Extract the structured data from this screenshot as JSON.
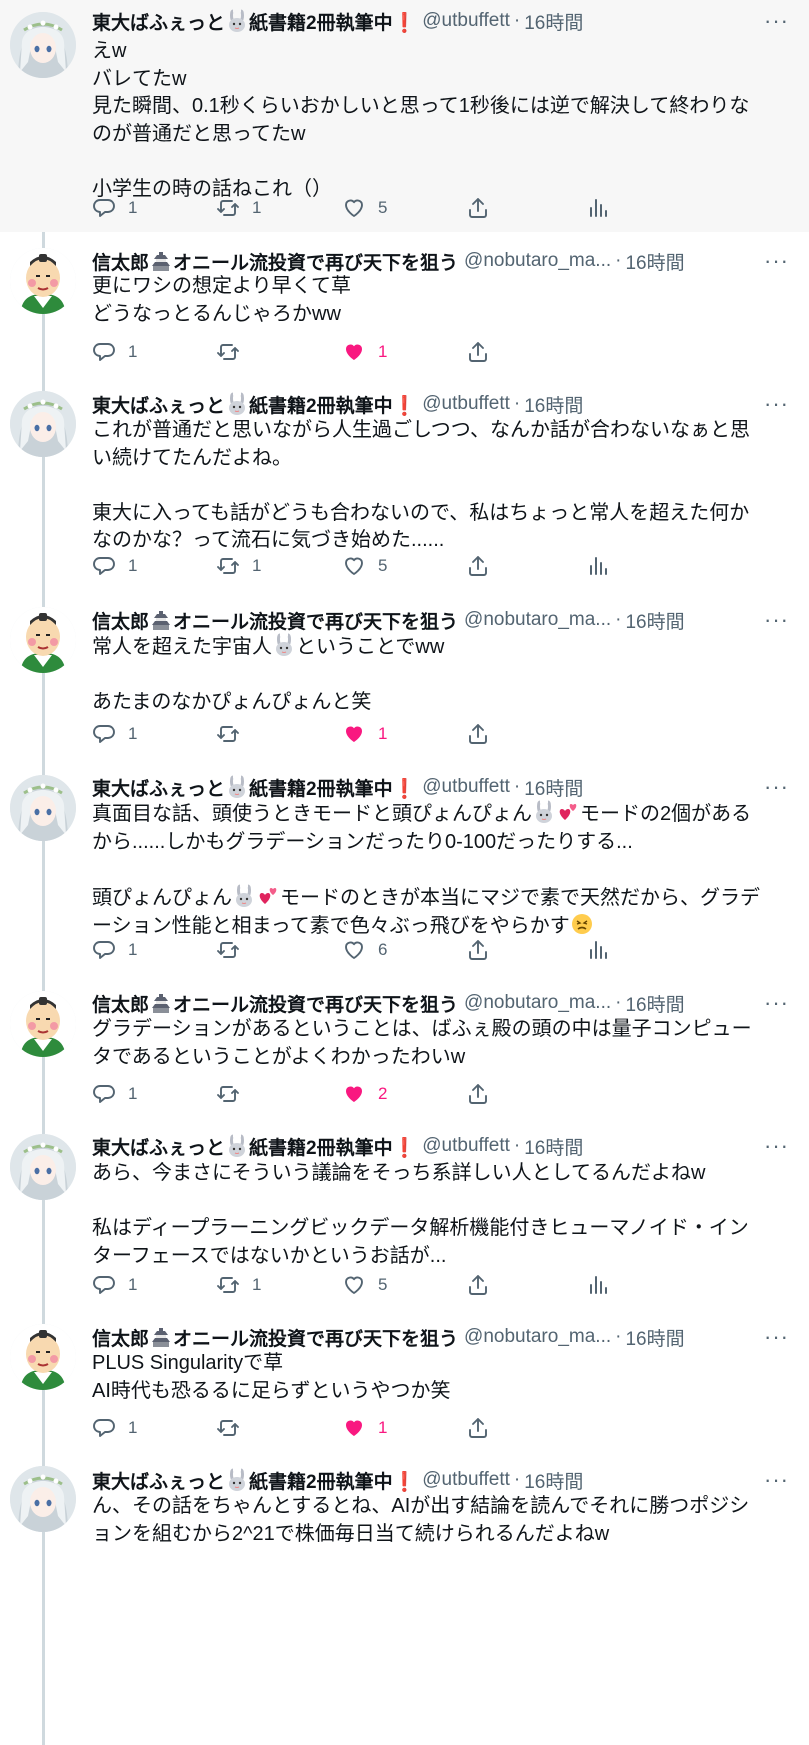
{
  "users": {
    "todai": {
      "name_prefix": "東大ばふぇっと",
      "name_suffix": "紙書籍2冊執筆中",
      "excl": "❗",
      "handle": "@utbuffett"
    },
    "nobu": {
      "name_prefix": "信太郎",
      "name_suffix": "オニール流投資で再び天下を狙う",
      "handle": "@nobutaro_ma..."
    }
  },
  "dot": "·",
  "more": "···",
  "tweets": [
    {
      "user": "todai",
      "time": "16時間",
      "lines": [
        "えw",
        "バレてたw",
        "見た瞬間、0.1秒くらいおかしいと思って1秒後には逆で解決して終わりな",
        "のが普通だと思ってたw",
        "",
        "小学生の時の話ねこれ（）"
      ],
      "reply": "1",
      "retweet": "1",
      "like": "5"
    },
    {
      "user": "nobu",
      "time": "16時間",
      "lines": [
        "更にワシの想定より早くて草",
        "どうなっとるんじゃろかww"
      ],
      "reply": "1",
      "retweet": "",
      "like": "1"
    },
    {
      "user": "todai",
      "time": "16時間",
      "lines": [
        "これが普通だと思いながら人生過ごしつつ、なんか話が合わないなぁと思",
        "い続けてたんだよね。",
        "",
        "東大に入っても話がどうも合わないので、私はちょっと常人を超えた何か",
        "なのかな？って流石に気づき始めた......"
      ],
      "reply": "1",
      "retweet": "1",
      "like": "5"
    },
    {
      "user": "nobu",
      "time": "16時間",
      "lines": [
        "常人を超えた宇宙人{bunny}ということでww",
        "",
        "あたまのなかぴょんぴょんと笑"
      ],
      "reply": "1",
      "retweet": "",
      "like": "1"
    },
    {
      "user": "todai",
      "time": "16時間",
      "lines": [
        "真面目な話、頭使うときモードと頭ぴょんぴょん{bunny}{hearts}モードの2個がある",
        "から......しかもグラデーションだったり0-100だったりする...",
        "",
        "頭ぴょんぴょん{bunny}{hearts}モードのときが本当にマジで素で天然だから、グラデ",
        "ーション性能と相まって素で色々ぶっ飛びをやらかす{persevere}"
      ],
      "reply": "1",
      "retweet": "",
      "like": "6"
    },
    {
      "user": "nobu",
      "time": "16時間",
      "lines": [
        "グラデーションがあるということは、ばふぇ殿の頭の中は量子コンピュー",
        "タであるということがよくわかったわいw"
      ],
      "reply": "1",
      "retweet": "",
      "like": "2"
    },
    {
      "user": "todai",
      "time": "16時間",
      "lines": [
        "あら、今まさにそういう議論をそっち系詳しい人としてるんだよねw",
        "",
        "私はディープラーニングビックデータ解析機能付きヒューマノイド・イン",
        "ターフェースではないかというお話が..."
      ],
      "reply": "1",
      "retweet": "1",
      "like": "5"
    },
    {
      "user": "nobu",
      "time": "16時間",
      "lines": [
        "PLUS Singularityで草",
        "AI時代も恐るるに足らずというやつか笑"
      ],
      "reply": "1",
      "retweet": "",
      "like": "1"
    },
    {
      "user": "todai",
      "time": "16時間",
      "lines": [
        "ん、その話をちゃんとするとね、AIが出す結論を読んでそれに勝つポジシ",
        "ョンを組むから2^21で株価毎日当て続けられるんだよねw"
      ],
      "reply": "",
      "retweet": "",
      "like": ""
    }
  ]
}
